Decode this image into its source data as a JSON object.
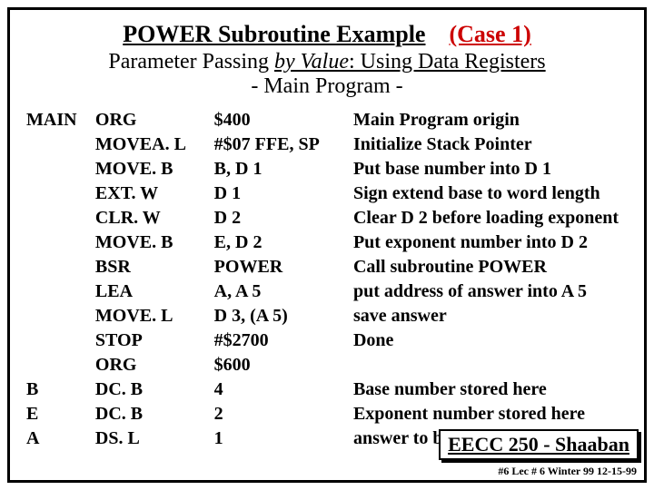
{
  "title": {
    "line1_main": "POWER Subroutine Example",
    "line1_case": "(Case 1)",
    "line2_pre": "Parameter Passing ",
    "line2_italic": "by Value",
    "line2_post": ": Using Data Registers",
    "line3": "- Main Program -"
  },
  "rows": [
    {
      "label": "MAIN",
      "op": "ORG",
      "arg": "$400",
      "comment": "Main Program origin"
    },
    {
      "label": "",
      "op": "MOVEA. L",
      "arg": "#$07 FFE, SP",
      "comment": "Initialize  Stack Pointer"
    },
    {
      "label": "",
      "op": "MOVE. B",
      "arg": "B, D 1",
      "comment": "Put base number into D 1"
    },
    {
      "label": "",
      "op": "EXT. W",
      "arg": "D 1",
      "comment": "Sign extend base to word length"
    },
    {
      "label": "",
      "op": "CLR. W",
      "arg": "D 2",
      "comment": "Clear D 2 before loading exponent"
    },
    {
      "label": "",
      "op": "MOVE. B",
      "arg": "E, D 2",
      "comment": "Put exponent number into D 2"
    },
    {
      "label": "",
      "op": "BSR",
      "arg": "POWER",
      "comment": "Call subroutine  POWER"
    },
    {
      "label": "",
      "op": "LEA",
      "arg": "A, A 5",
      "comment": " put address of  answer into A 5"
    },
    {
      "label": "",
      "op": "MOVE. L",
      "arg": "D 3, (A 5)",
      "comment": "save  answer"
    },
    {
      "label": "",
      "op": "STOP",
      "arg": "#$2700",
      "comment": "Done"
    },
    {
      "label": "",
      "op": "ORG",
      "arg": "$600",
      "comment": ""
    },
    {
      "label": "B",
      "op": "DC. B",
      "arg": "4",
      "comment": "Base number stored here"
    },
    {
      "label": "E",
      "op": "DC. B",
      "arg": "2",
      "comment": "Exponent number stored here"
    },
    {
      "label": "A",
      "op": "DS. L",
      "arg": "1",
      "comment": "answer to be stored  here"
    }
  ],
  "footer": {
    "box": "EECC 250 - Shaaban",
    "small": "#6   Lec # 6  Winter 99  12-15-99"
  }
}
